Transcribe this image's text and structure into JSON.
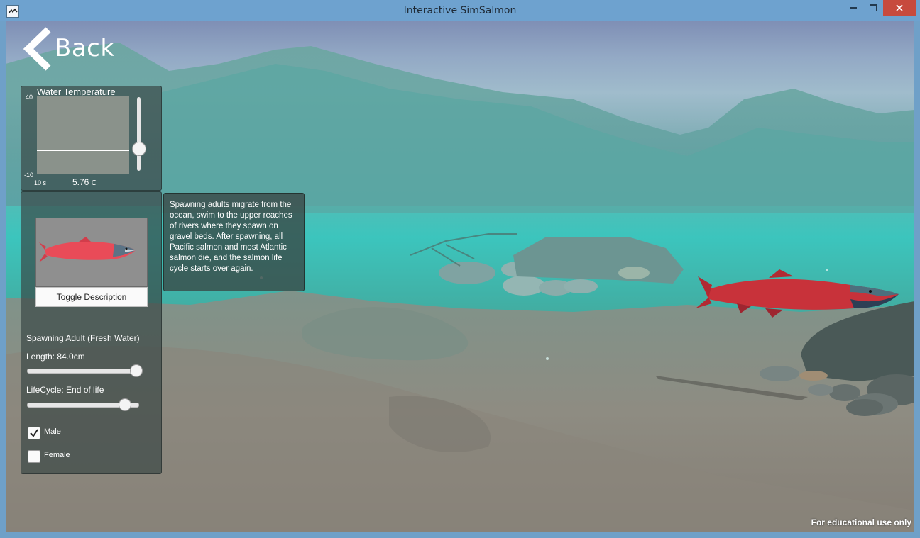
{
  "window": {
    "title": "Interactive SimSalmon",
    "controls": [
      "minimize-icon",
      "maximize-icon",
      "close-icon"
    ]
  },
  "navigation": {
    "back_label": "Back"
  },
  "temperature": {
    "title": "Water Temperature",
    "axis_max": "40",
    "axis_min": "-10",
    "time_label": "10 s",
    "value_text": "5.76",
    "unit": "C",
    "level_fraction": 0.31
  },
  "description": {
    "text": "Spawning adults migrate from the ocean, swim to the upper reaches of rivers where they spawn on gravel beds. After spawning, all Pacific salmon and most Atlantic salmon die, and the salmon life cycle starts over again."
  },
  "controls": {
    "toggle_description_label": "Toggle Description",
    "stage_label": "Spawning Adult (Fresh Water)",
    "length_label": "Length: 84.0cm",
    "length_fraction": 0.98,
    "lifecycle_label": "LifeCycle: End of life",
    "lifecycle_fraction": 0.88,
    "male_label": "Male",
    "male_checked": true,
    "female_label": "Female",
    "female_checked": false
  },
  "footer": {
    "note": "For educational use only"
  },
  "colors": {
    "salmon_red": "#c8323a",
    "water_teal": "#3fc2bb",
    "close_red": "#c74a3d"
  }
}
